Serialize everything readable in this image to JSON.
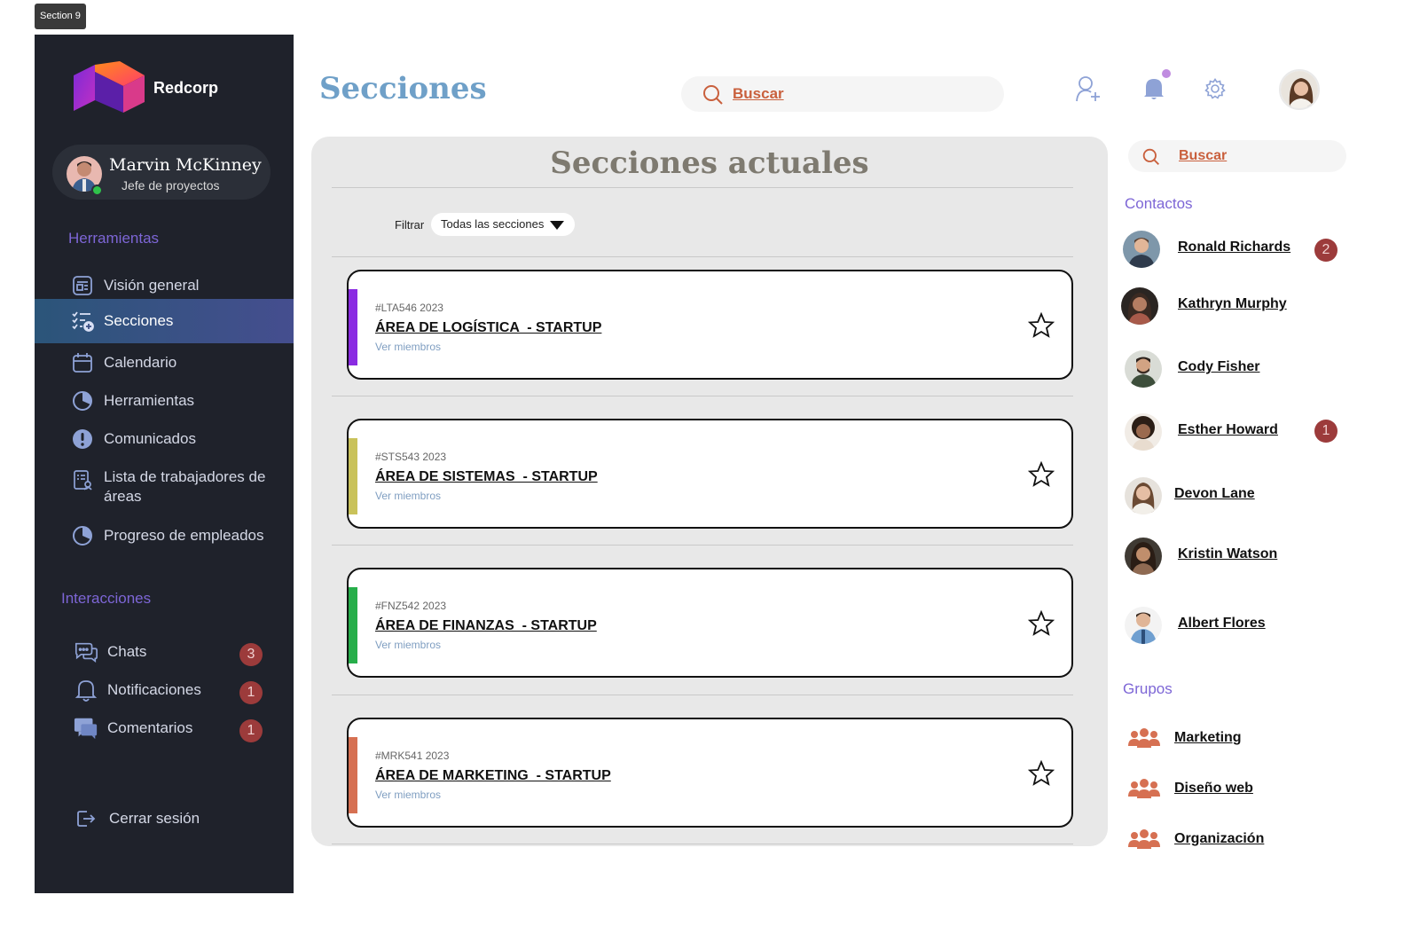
{
  "frame_label": "Section 9",
  "brand": {
    "name": "Redcorp"
  },
  "profile": {
    "name": "Marvin McKinney",
    "role": "Jefe de proyectos"
  },
  "sidebar": {
    "tools_heading": "Herramientas",
    "items": [
      {
        "label": "Visión general",
        "icon": "dashboard-icon"
      },
      {
        "label": "Secciones",
        "icon": "checklist-icon",
        "active": true
      },
      {
        "label": "Calendario",
        "icon": "calendar-icon"
      },
      {
        "label": "Herramientas",
        "icon": "pie-chart-icon"
      },
      {
        "label": "Comunicados",
        "icon": "alert-icon"
      },
      {
        "label": "Lista de trabajadores de áreas",
        "icon": "worker-list-icon"
      },
      {
        "label": "Progreso de empleados",
        "icon": "pie-chart-icon"
      }
    ],
    "interactions_heading": "Interacciones",
    "interactions": [
      {
        "label": "Chats",
        "badge": "3",
        "icon": "chat-icon"
      },
      {
        "label": "Notificaciones",
        "badge": "1",
        "icon": "bell-icon"
      },
      {
        "label": "Comentarios",
        "badge": "1",
        "icon": "comments-icon"
      }
    ],
    "logout": "Cerrar sesión"
  },
  "header": {
    "title": "Secciones",
    "search_label": "Buscar"
  },
  "main": {
    "title": "Secciones actuales",
    "filter_label": "Filtrar",
    "filter_value": "Todas las secciones",
    "cards": [
      {
        "code": "#LTA546 2023",
        "name": "ÁREA DE LOGÍSTICA  - STARTUP",
        "members": "Ver miembros",
        "color": "#8a2be2"
      },
      {
        "code": "#STS543 2023",
        "name": "ÁREA DE SISTEMAS  - STARTUP",
        "members": "Ver miembros",
        "color": "#c9c25a"
      },
      {
        "code": "#FNZ542 2023",
        "name": "ÁREA DE FINANZAS  - STARTUP",
        "members": "Ver miembros",
        "color": "#27ae4a"
      },
      {
        "code": "#MRK541 2023",
        "name": "ÁREA DE MARKETING  - STARTUP",
        "members": "Ver miembros",
        "color": "#d67052"
      }
    ]
  },
  "right": {
    "search_label": "Buscar",
    "contacts_heading": "Contactos",
    "contacts": [
      {
        "name": "Ronald Richards",
        "badge": "2"
      },
      {
        "name": "Kathryn Murphy"
      },
      {
        "name": "Cody Fisher"
      },
      {
        "name": "Esther Howard",
        "badge": "1"
      },
      {
        "name": "Devon Lane"
      },
      {
        "name": "Kristin Watson"
      },
      {
        "name": "Albert Flores"
      }
    ],
    "groups_heading": "Grupos",
    "groups": [
      {
        "name": "Marketing"
      },
      {
        "name": "Diseño web"
      },
      {
        "name": "Organización"
      }
    ]
  },
  "colors": {
    "accent": "#7d66d6",
    "title_blue": "#6fa0c8",
    "search_orange": "#c9603d",
    "badge_red": "#9c3b3b",
    "sidebar_bg": "#1f222b"
  }
}
